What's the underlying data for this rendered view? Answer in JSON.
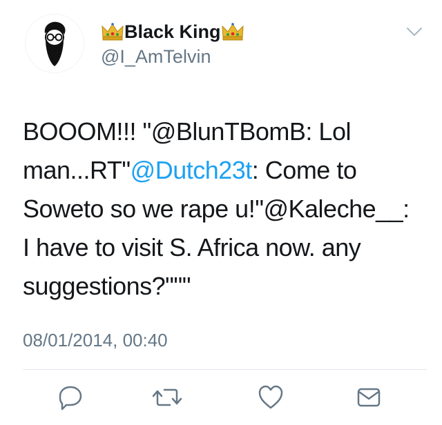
{
  "user": {
    "name": "Black King",
    "handle": "@I_AmTelvin"
  },
  "tweet": {
    "text_part1": "BOOOM!!! \"@BlunTBomB: Lol man...RT\"",
    "mention": "@Dutch23t",
    "text_part2": ": Come to Soweto so we rape u!\"@Kaleche__: I have to visit S. Africa now. any suggestions?\"\"\"",
    "timestamp": "08/01/2014, 00:40"
  },
  "actions": {
    "reply_icon": "reply-icon",
    "retweet_icon": "retweet-icon",
    "like_icon": "heart-icon",
    "dm_icon": "envelope-icon"
  },
  "colors": {
    "link": "#1da1f2",
    "secondary_text": "#657786",
    "primary_text": "#14171a",
    "icon": "#657786",
    "crown": "#e8b830"
  }
}
